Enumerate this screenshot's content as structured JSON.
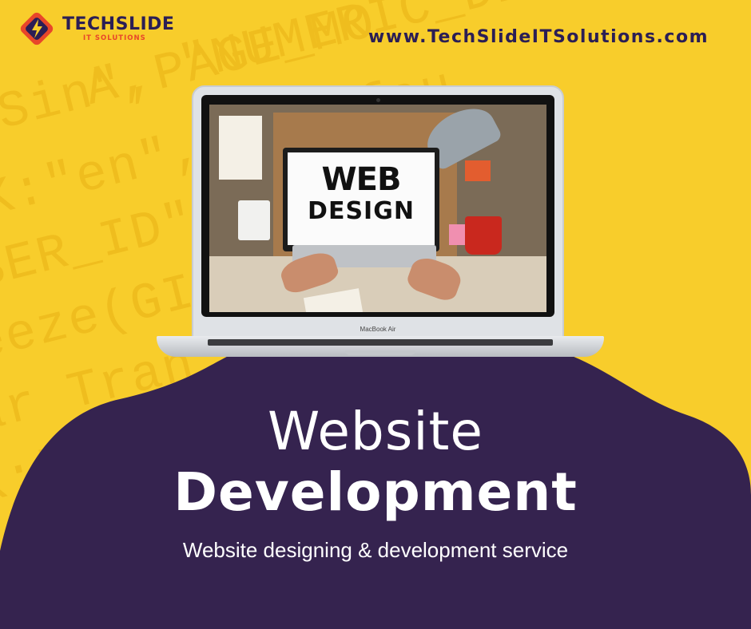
{
  "logo": {
    "name": "TECHSLIDE",
    "subtitle": "IT SOLUTIONS",
    "icon": "lightning-bolt-icon"
  },
  "website_url": "www.TechSlideITSolutions.com",
  "background": {
    "code_lines": [
      "A, \"NUMERIC_DELIMITER\":\"0sD\"",
      "Sin\",PAGE_MO",
      "K:\"en\",\"  \"defau",
      "SER_ID\":  N:121",
      "eeze(GI  S_STU",
      "ar Tran   e){",
      "K:\"OK\"",
      "ic"
    ]
  },
  "laptop": {
    "brand": "MacBook Air",
    "screen_text_line1": "WEB",
    "screen_text_line2": "DESIGN"
  },
  "headline": {
    "line1": "Website",
    "line2": "Development",
    "subtitle": "Website designing & development service"
  },
  "colors": {
    "background": "#f8cd2b",
    "purple": "#35234f",
    "navy_text": "#2b1e55",
    "accent_orange": "#e8462a"
  }
}
